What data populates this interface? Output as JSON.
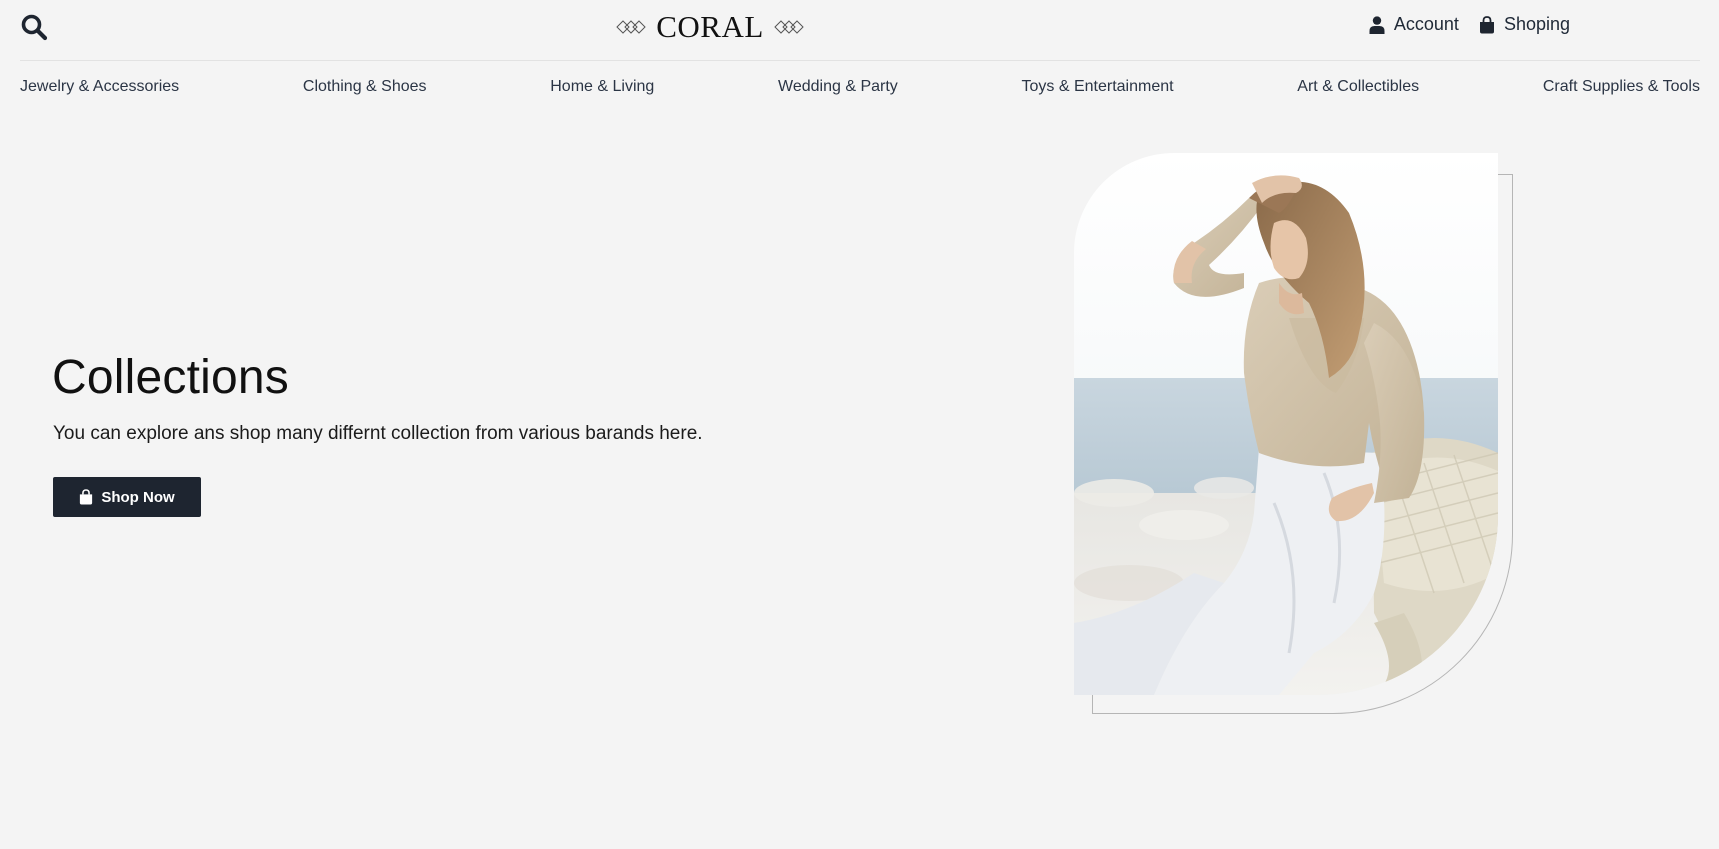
{
  "header": {
    "logo_text": "CORAL",
    "account_label": "Account",
    "shopping_label": "Shoping"
  },
  "nav": {
    "items": [
      {
        "label": "Jewelry & Accessories"
      },
      {
        "label": "Clothing & Shoes"
      },
      {
        "label": "Home & Living"
      },
      {
        "label": "Wedding & Party"
      },
      {
        "label": "Toys & Entertainment"
      },
      {
        "label": "Art & Collectibles"
      },
      {
        "label": "Craft Supplies & Tools"
      }
    ]
  },
  "hero": {
    "title": "Collections",
    "description": "You can explore ans shop many differnt collection from various barands here.",
    "button_label": "Shop Now"
  },
  "icons": {
    "search": "search-icon",
    "account": "user-icon",
    "shopping": "shopping-bag-icon",
    "logo_decor": "diamond-pattern-icon"
  },
  "colors": {
    "background": "#f4f4f4",
    "button": "#1e2530",
    "text": "#1f2937"
  }
}
